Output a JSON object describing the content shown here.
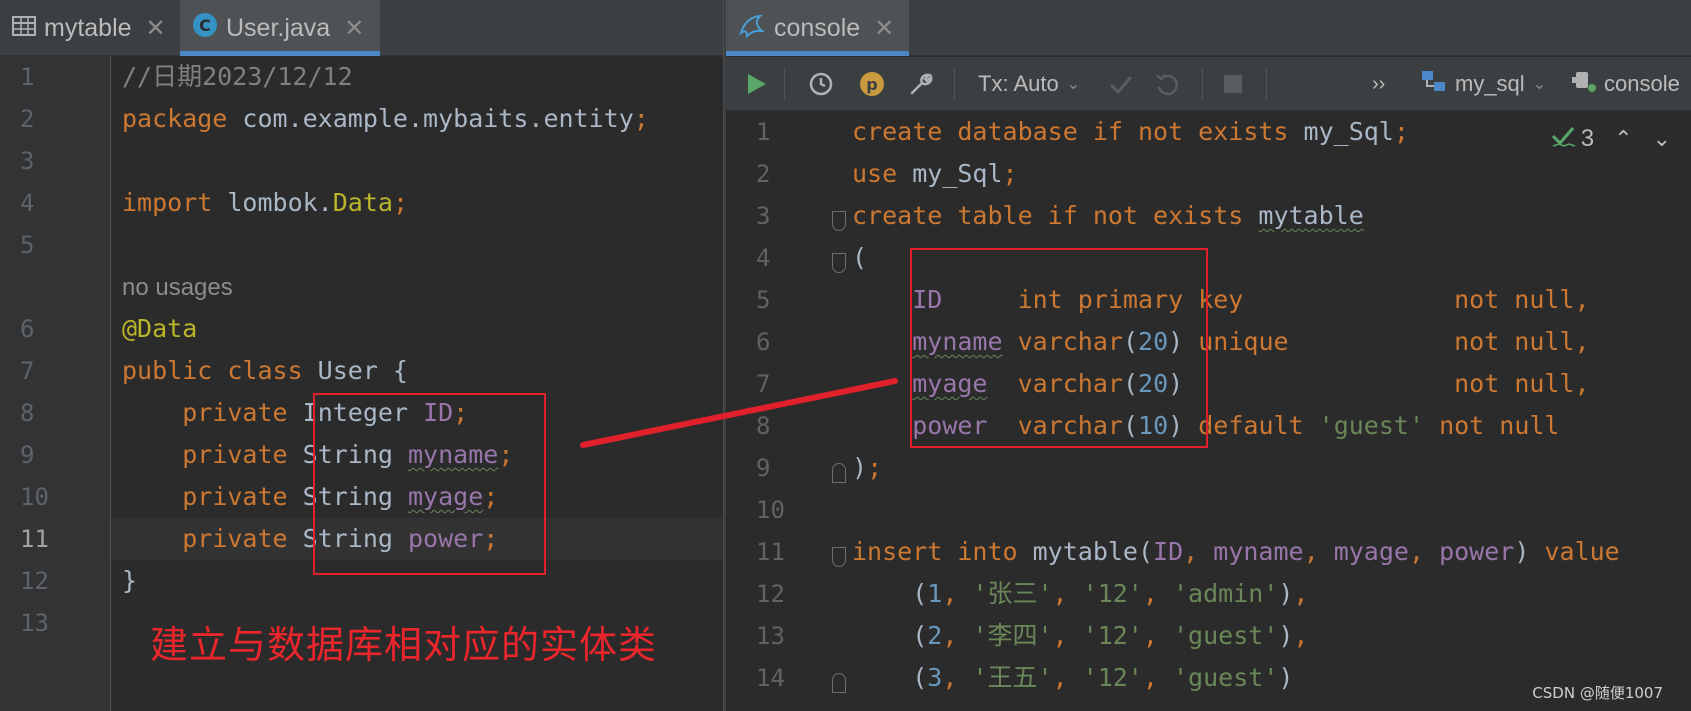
{
  "left_tabs": [
    {
      "label": "mytable",
      "icon": "table-icon"
    },
    {
      "label": "User.java",
      "icon": "class-icon"
    }
  ],
  "right_tabs": [
    {
      "label": "console",
      "icon": "mysql-icon"
    }
  ],
  "toolbar": {
    "tx_label": "Tx: Auto",
    "datasource": "my_sql",
    "session": "console",
    "more": "››",
    "inspection_count": "3"
  },
  "java_editor": {
    "line_numbers": [
      "1",
      "2",
      "3",
      "4",
      "5",
      "6",
      "7",
      "8",
      "9",
      "10",
      "11",
      "12",
      "13"
    ],
    "usage_hint": "no usages"
  },
  "sql_editor": {
    "line_numbers": [
      "1",
      "2",
      "3",
      "4",
      "5",
      "6",
      "7",
      "8",
      "9",
      "10",
      "11",
      "12",
      "13",
      "14"
    ]
  },
  "annotation_text": "建立与数据库相对应的实体类",
  "watermark": "CSDN @随便1007",
  "colors": {
    "background": "#2b2b2b",
    "keyword": "#cc7832",
    "string": "#6a8759",
    "number": "#6897bb",
    "field": "#9876aa",
    "annotation": "#bbb529",
    "highlight_box": "#e0202a"
  }
}
